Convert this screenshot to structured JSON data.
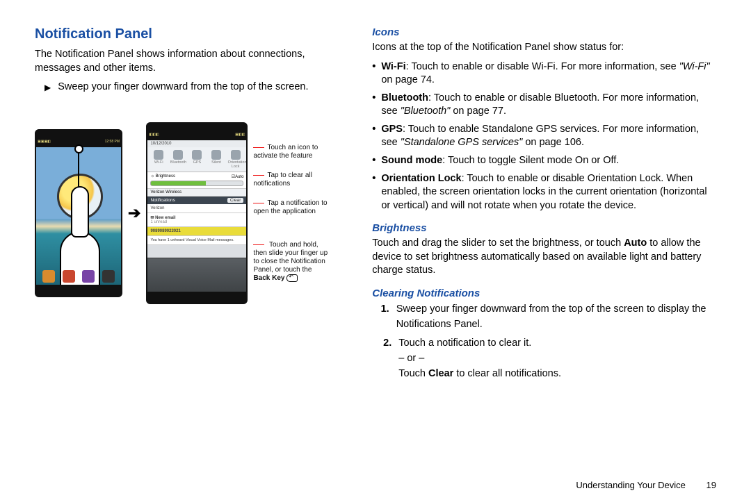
{
  "left": {
    "title": "Notification Panel",
    "intro": "The Notification Panel shows information about connections, messages and other items.",
    "instruction": "Sweep your finger downward from the top of the screen.",
    "callouts": {
      "c1": "Touch an icon to activate the feature",
      "c2": "Tap to clear all notifications",
      "c3": "Tap a notification to open the application",
      "c4_pre": "Touch and hold, then slide your finger up to close the Notification Panel, or touch the",
      "c4_key": "Back Key"
    },
    "panel": {
      "date": "10/12/2010",
      "icons": [
        "Wi-Fi",
        "Bluetooth",
        "GPS",
        "Silent",
        "Orientation Lock"
      ],
      "brightness_label": "Brightness",
      "auto": "Auto",
      "notifications_header": "Notifications",
      "clear": "Clear",
      "carrier": "Verizon Wireless",
      "verizon": "Verizon",
      "newemail_title": "New email",
      "newemail_sub": "1 unread",
      "vvm_num": "9089089023021",
      "vvm_sub": "You have 1 unheard Visual Voice Mail messages."
    },
    "status_time": "12:58 PM"
  },
  "right": {
    "icons_head": "Icons",
    "icons_intro": "Icons at the top of the Notification Panel show status for:",
    "wifi_b": "Wi-Fi",
    "wifi_txt": ": Touch to enable or disable Wi-Fi. For more information, see ",
    "wifi_i": "\"Wi-Fi\"",
    "wifi_pg": " on page 74.",
    "bt_b": "Bluetooth",
    "bt_txt": ": Touch to enable or disable Bluetooth. For more information, see ",
    "bt_i": "\"Bluetooth\"",
    "bt_pg": " on page 77.",
    "gps_b": "GPS",
    "gps_txt": ": Touch to enable Standalone GPS services. For more information, see ",
    "gps_i": "\"Standalone GPS services\"",
    "gps_pg": " on page 106.",
    "sound_b": "Sound mode",
    "sound_txt": ": Touch to toggle Silent mode On or Off.",
    "orient_b": "Orientation Lock",
    "orient_txt": ": Touch to enable or disable Orientation Lock. When enabled, the screen orientation locks in the current orientation (horizontal or vertical) and will not rotate when you rotate the device.",
    "brightness_head": "Brightness",
    "brightness_p_a": "Touch and drag the slider to set the brightness, or touch ",
    "brightness_p_bold": "Auto",
    "brightness_p_b": " to allow the device to set brightness automatically based on available light and battery charge status.",
    "clearing_head": "Clearing Notifications",
    "step1": "Sweep your finger downward from the top of the screen to display the Notifications Panel.",
    "step2a": "Touch a notification to clear it.",
    "step2or": "– or –",
    "step2b_a": "Touch ",
    "step2b_bold": "Clear",
    "step2b_b": " to clear all notifications."
  },
  "footer": {
    "section": "Understanding Your Device",
    "page": "19"
  }
}
